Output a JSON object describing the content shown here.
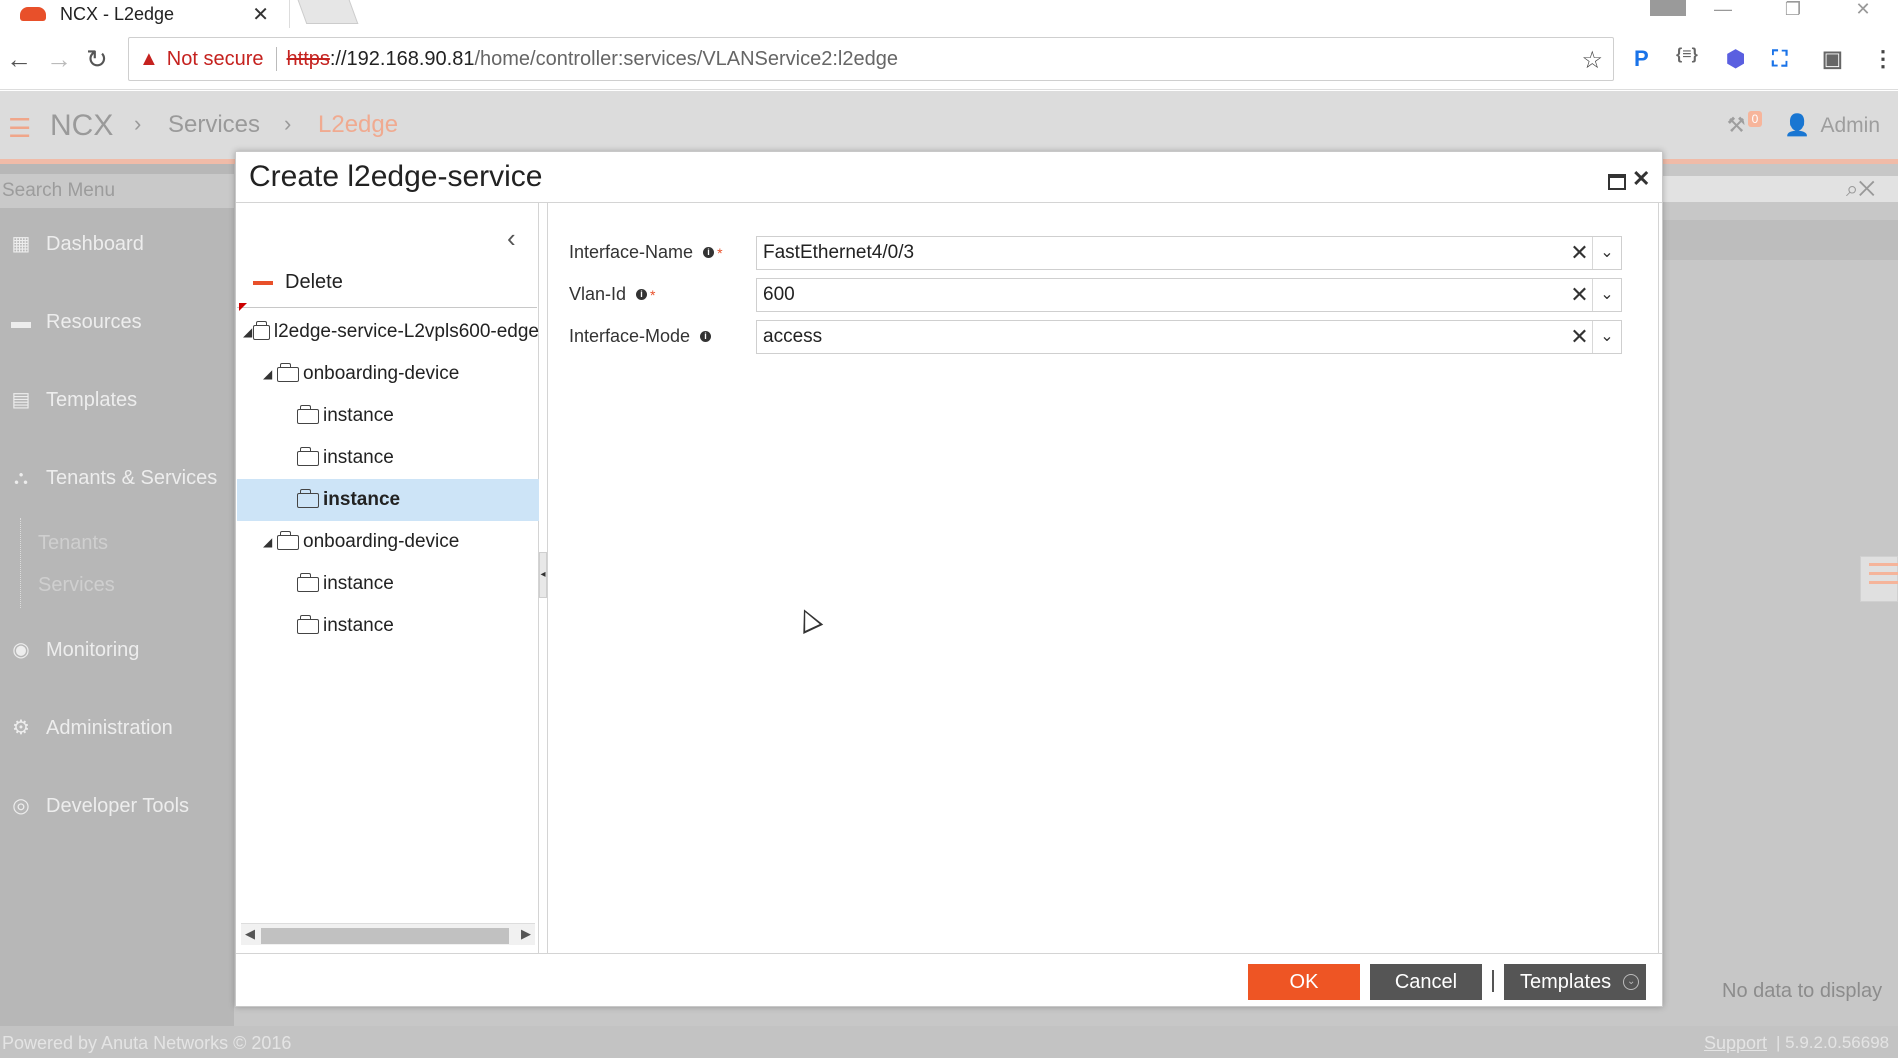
{
  "browser": {
    "tab_title": "NCX - L2edge",
    "tab_close": "✕",
    "not_secure": "Not secure",
    "url_scheme": "https",
    "url_host": "://192.168.90.81",
    "url_path": "/home/controller:services/VLANService2:l2edge"
  },
  "header": {
    "brand": "NCX",
    "breadcrumb_services": "Services",
    "breadcrumb_current": "L2edge",
    "notification_count": "0",
    "user": "Admin"
  },
  "sidebar": {
    "search_placeholder": "Search Menu",
    "items": [
      {
        "label": "Dashboard",
        "icon": "dashboard-icon"
      },
      {
        "label": "Resources",
        "icon": "briefcase-icon"
      },
      {
        "label": "Templates",
        "icon": "template-icon"
      },
      {
        "label": "Tenants & Services",
        "icon": "hierarchy-icon"
      },
      {
        "label": "Monitoring",
        "icon": "eye-icon"
      },
      {
        "label": "Administration",
        "icon": "gears-icon"
      },
      {
        "label": "Developer Tools",
        "icon": "dev-tools-icon"
      }
    ],
    "sub_items": [
      "Tenants",
      "Services"
    ]
  },
  "background": {
    "no_data": "No data to display"
  },
  "footer": {
    "powered_by": "Powered by Anuta Networks © 2016",
    "support": "Support",
    "version": "| 5.9.2.0.56698"
  },
  "modal": {
    "title": "Create l2edge-service",
    "delete_label": "Delete",
    "tree": [
      {
        "label": "l2edge-service-L2vpls600-edge",
        "level": 0,
        "expanded": true,
        "selected": false
      },
      {
        "label": "onboarding-device",
        "level": 1,
        "expanded": true,
        "selected": false
      },
      {
        "label": "instance",
        "level": 2,
        "selected": false
      },
      {
        "label": "instance",
        "level": 2,
        "selected": false
      },
      {
        "label": "instance",
        "level": 2,
        "selected": true
      },
      {
        "label": "onboarding-device",
        "level": 1,
        "expanded": true,
        "selected": false
      },
      {
        "label": "instance",
        "level": 2,
        "selected": false
      },
      {
        "label": "instance",
        "level": 2,
        "selected": false
      }
    ],
    "fields": [
      {
        "label": "Interface-Name",
        "value": "FastEthernet4/0/3",
        "required": true
      },
      {
        "label": "Vlan-Id",
        "value": "600",
        "required": true
      },
      {
        "label": "Interface-Mode",
        "value": "access",
        "required": false
      }
    ],
    "buttons": {
      "ok": "OK",
      "cancel": "Cancel",
      "templates": "Templates"
    }
  }
}
